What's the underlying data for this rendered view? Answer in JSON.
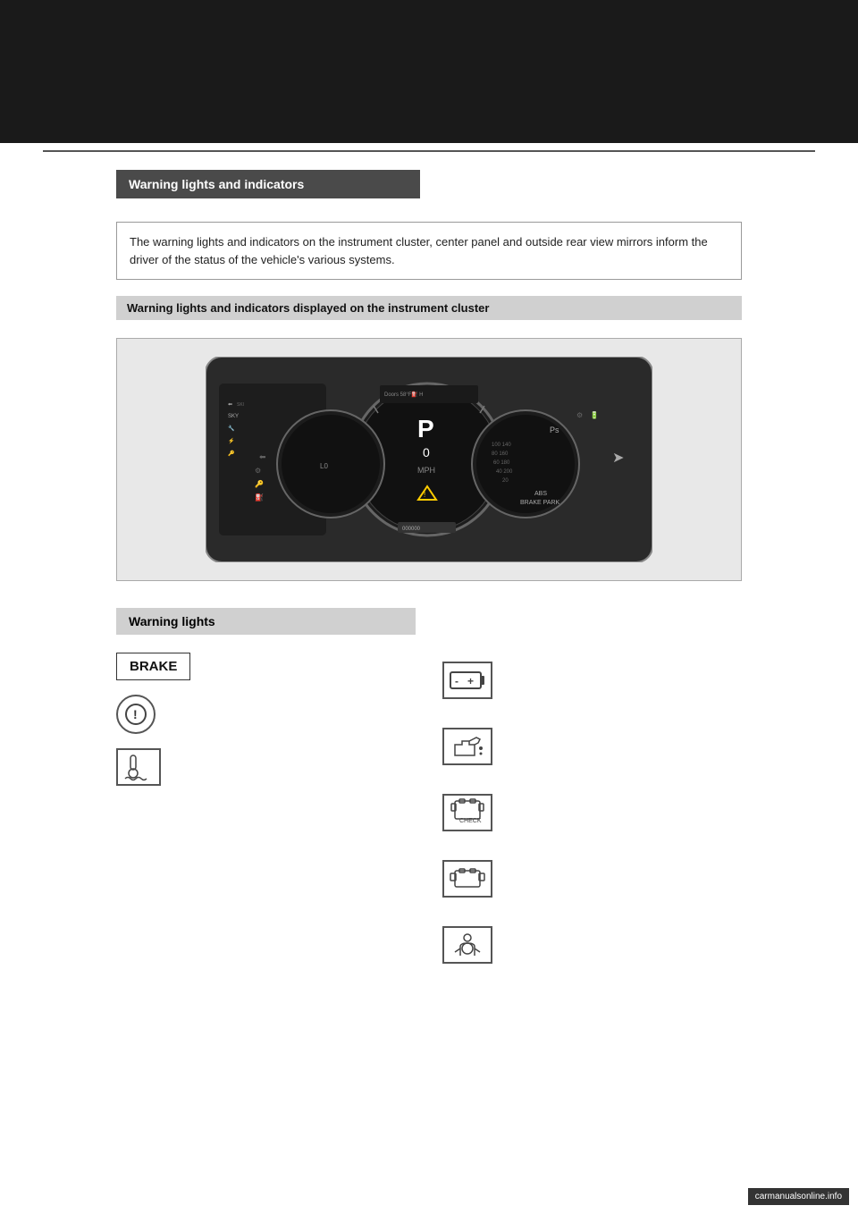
{
  "page": {
    "top_bar_height": 160,
    "background_color": "#ffffff"
  },
  "header": {
    "section_title": "Warning lights and indicators"
  },
  "info_box": {
    "text": "The warning lights and indicators on the instrument cluster, center panel and outside rear view mirrors inform the driver of the status of the vehicle's various systems."
  },
  "sub_section": {
    "title": "Warning lights and indicators displayed on the instrument cluster"
  },
  "warning_lights": {
    "section_title": "Warning lights",
    "icons_left": [
      {
        "id": "brake",
        "label": "BRAKE",
        "type": "text"
      },
      {
        "id": "master-warning",
        "label": "!",
        "type": "circle"
      },
      {
        "id": "coolant",
        "label": "coolant",
        "type": "coolant"
      }
    ],
    "icons_right": [
      {
        "id": "battery",
        "label": "battery",
        "type": "battery"
      },
      {
        "id": "oil",
        "label": "oil",
        "type": "oil"
      },
      {
        "id": "check-engine",
        "label": "CHECK",
        "type": "check"
      },
      {
        "id": "engine",
        "label": "engine",
        "type": "engine"
      },
      {
        "id": "airbag",
        "label": "airbag",
        "type": "airbag"
      }
    ]
  },
  "watermark": {
    "text": "carmanualsonline.info"
  }
}
